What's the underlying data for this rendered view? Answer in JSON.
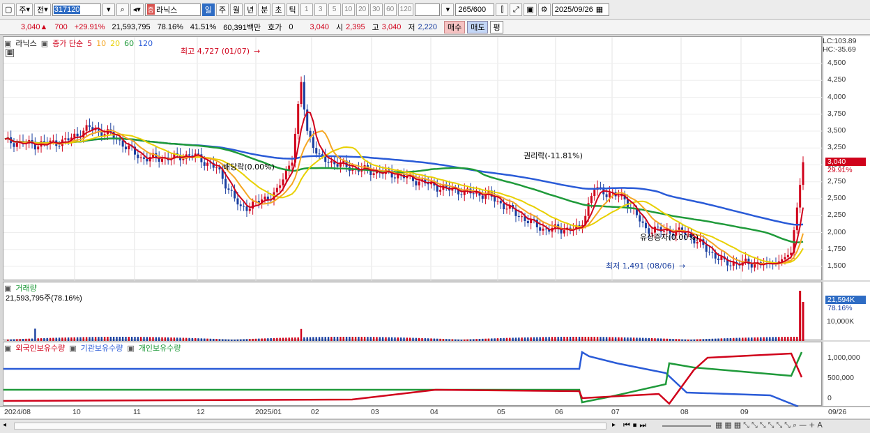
{
  "toolbar": {
    "mode_label": "주",
    "prev_label": "전",
    "code": "317120",
    "stock_name": "라닉스",
    "badge": "증",
    "periods": [
      "일",
      "주",
      "월",
      "년",
      "분",
      "초",
      "틱"
    ],
    "active_period": "일",
    "intervals": [
      "1",
      "3",
      "5",
      "10",
      "20",
      "30",
      "60",
      "120"
    ],
    "count": "265",
    "count_total": "/600",
    "date": "2025/09/26"
  },
  "quote": {
    "price": "3,040",
    "change": "700",
    "change_pct": "+29.91%",
    "volume": "21,593,795",
    "vol_ratio": "78.16%",
    "turnover": "41.51%",
    "amount": "60,391백만",
    "hoga_label": "호가",
    "hoga_value": "0",
    "hoga_price": "3,040",
    "open_label": "시",
    "open": "2,395",
    "high_label": "고",
    "high": "3,040",
    "low_label": "저",
    "low": "2,220",
    "buy_label": "매수",
    "sell_label": "매도",
    "eval_label": "평"
  },
  "price_panel": {
    "title": "라닉스",
    "ma_label": "종가 단순",
    "ma_periods": [
      {
        "p": "5",
        "color": "#d0021b"
      },
      {
        "p": "10",
        "color": "#f5a623"
      },
      {
        "p": "20",
        "color": "#e8d000"
      },
      {
        "p": "60",
        "color": "#1f9a3a"
      },
      {
        "p": "120",
        "color": "#2a5bd7"
      }
    ],
    "lc": "LC:103.89",
    "hc": "HC:-35.69",
    "y_ticks": [
      "4,500",
      "4,250",
      "4,000",
      "3,750",
      "3,500",
      "3,250",
      "3,000",
      "2,750",
      "2,500",
      "2,250",
      "2,000",
      "1,750",
      "1,500"
    ],
    "last_price": "3,040",
    "last_pct": "29.91%",
    "high_annot": "최고 4,727 (01/07)",
    "low_annot": "최저 1,491 (08/06)",
    "rights_annot": "권리락(-11.81%)",
    "div_annot": "배당락(0.00%)",
    "capital_annot": "유상증자(0.00%)"
  },
  "volume_panel": {
    "title": "거래량",
    "value": "21,593,795주(78.16%)",
    "tag_value": "21,594K",
    "tag_pct": "78.16%",
    "tick": "10,000K"
  },
  "holdings_panel": {
    "series": [
      {
        "name": "외국인보유수량",
        "color": "#d0021b"
      },
      {
        "name": "기관보유수량",
        "color": "#2a5bd7"
      },
      {
        "name": "개인보유수량",
        "color": "#1f9a3a"
      }
    ],
    "ticks": [
      "1,000,000",
      "500,000",
      "0"
    ]
  },
  "x_labels": [
    "2024/08",
    "10",
    "11",
    "12",
    "2025/01",
    "02",
    "03",
    "04",
    "05",
    "06",
    "07",
    "08",
    "09",
    "09/26"
  ],
  "colors": {
    "up": "#d0021b",
    "down": "#1a3fa0",
    "accent": "#2e6cc4"
  }
}
